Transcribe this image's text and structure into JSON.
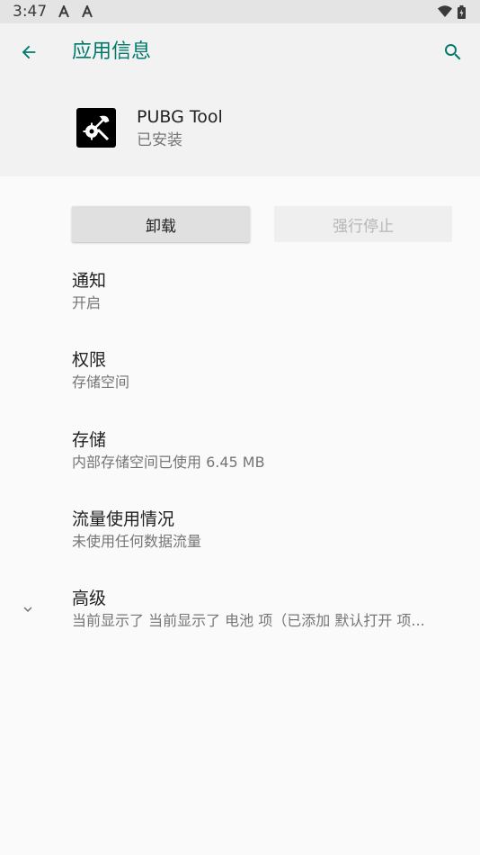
{
  "status_bar": {
    "time": "3:47",
    "left_icons": [
      "notification-a-icon",
      "notification-a-icon"
    ],
    "right_icons": [
      "wifi-icon",
      "battery-icon"
    ]
  },
  "app_bar": {
    "title": "应用信息",
    "accent_color": "#00796b"
  },
  "app": {
    "name": "PUBG Tool",
    "status": "已安装",
    "icon": "settings-wrench-icon"
  },
  "actions": {
    "uninstall": "卸载",
    "force_stop": "强行停止"
  },
  "prefs": [
    {
      "title": "通知",
      "summary": "开启"
    },
    {
      "title": "权限",
      "summary": "存储空间"
    },
    {
      "title": "存储",
      "summary": "内部存储空间已使用 6.45 MB"
    },
    {
      "title": "流量使用情况",
      "summary": "未使用任何数据流量"
    },
    {
      "title": "高级",
      "summary": "当前显示了 当前显示了 电池 项（已添加 默认打开 项..."
    }
  ]
}
